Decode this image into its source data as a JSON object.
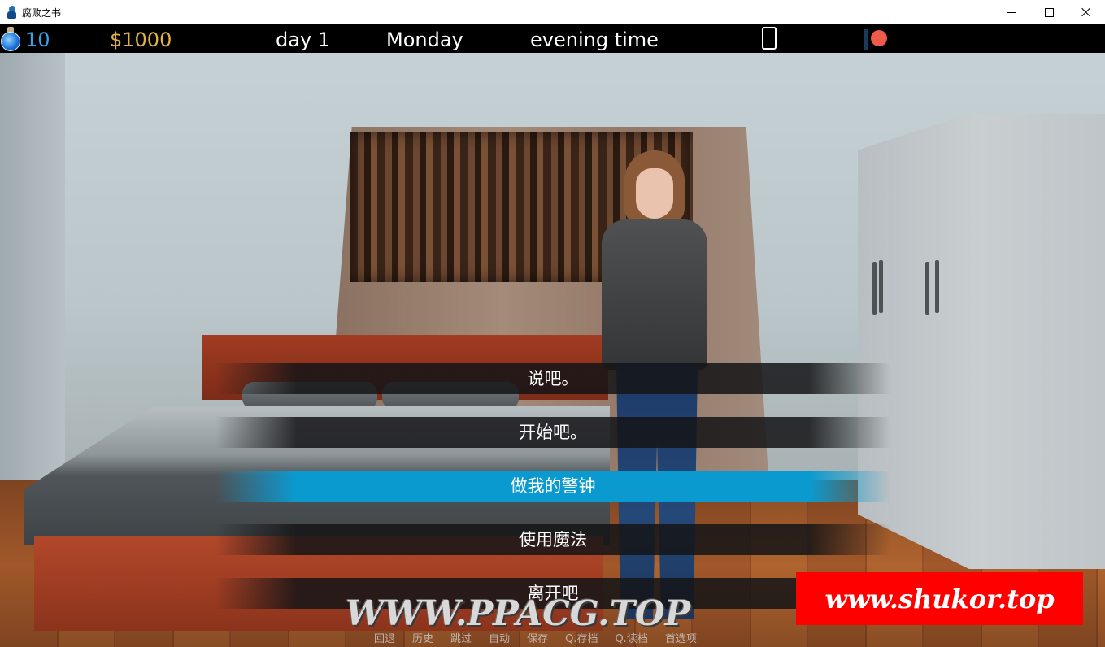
{
  "window": {
    "title": "腐败之书",
    "app_icon": "player-figure-icon",
    "controls": [
      "minimize",
      "maximize",
      "close"
    ]
  },
  "hud": {
    "mana": "10",
    "mana_icon": "potion-icon",
    "money": "$1000",
    "day": "day 1",
    "weekday": "Monday",
    "time_of_day": "evening time",
    "phone_icon": "phone-icon",
    "record_icon": "record-dot-icon",
    "colors": {
      "mana": "#3aa0e8",
      "money": "#e0b04a",
      "text": "#ffffff",
      "record": "#f05a4a"
    }
  },
  "menu": {
    "choices": [
      {
        "label": "说吧。",
        "selected": false
      },
      {
        "label": "开始吧。",
        "selected": false
      },
      {
        "label": "做我的警钟",
        "selected": true
      },
      {
        "label": "使用魔法",
        "selected": false
      },
      {
        "label": "离开吧",
        "selected": false
      }
    ],
    "selected_color": "#0b9ad0"
  },
  "quick_menu": {
    "items": [
      "回退",
      "历史",
      "跳过",
      "自动",
      "保存",
      "Q.存档",
      "Q.读档",
      "首选项"
    ]
  },
  "watermarks": {
    "ppacg": "WWW.PPACG.TOP",
    "shukor": "www.shukor.top"
  }
}
